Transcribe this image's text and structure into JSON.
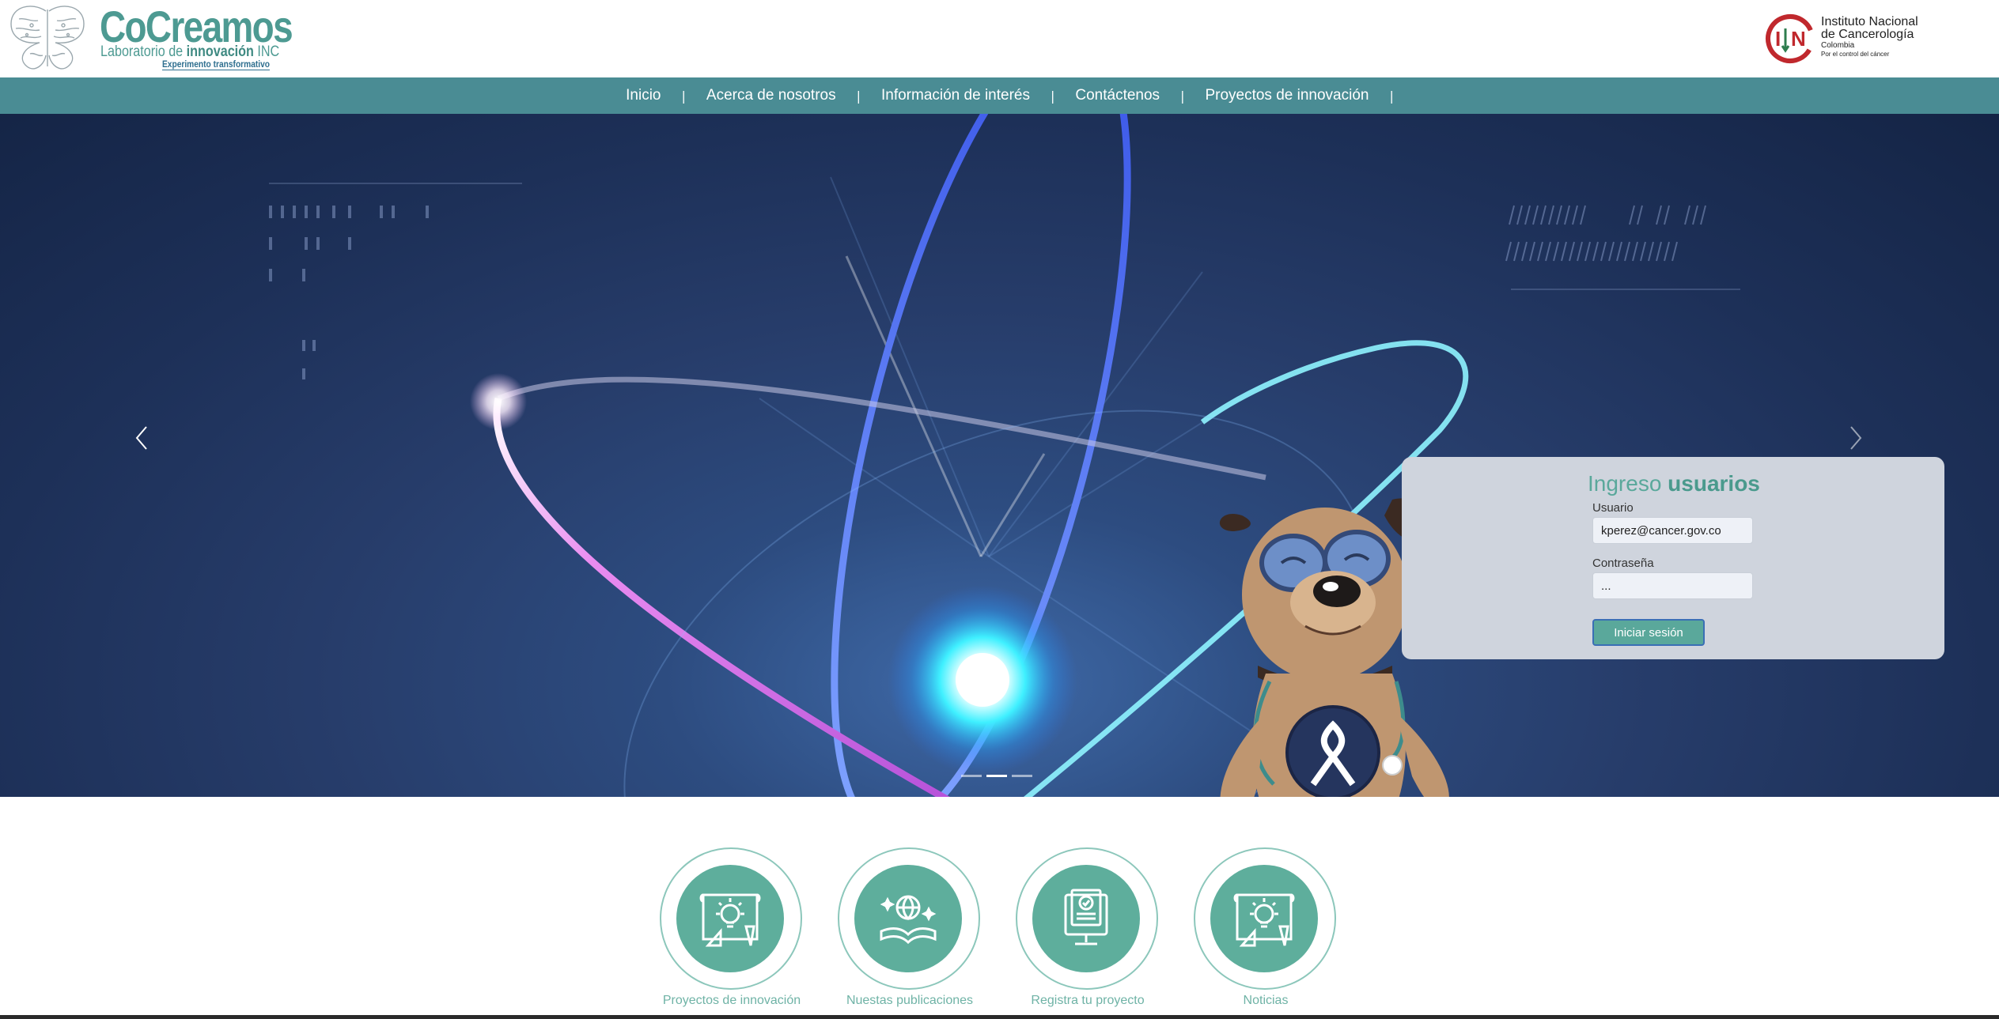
{
  "header": {
    "brand_title": "CoCreamos",
    "brand_sub_prefix": "Laboratorio de ",
    "brand_sub_bold": "innovación",
    "brand_sub_suffix": " INC",
    "brand_tagline": "Experimento transformativo",
    "institute_line1": "Instituto Nacional",
    "institute_line2": "de Cancerología",
    "institute_line3": "Colombia",
    "institute_line4": "Por el control del cáncer"
  },
  "nav": {
    "items": [
      {
        "label": "Inicio"
      },
      {
        "label": "Acerca de nosotros"
      },
      {
        "label": "Información de interés"
      },
      {
        "label": "Contáctenos"
      },
      {
        "label": "Proyectos de innovación"
      }
    ],
    "separator": "|"
  },
  "hero": {
    "prev_icon": "chevron-left-icon",
    "next_icon": "chevron-right-icon",
    "slides_count": 3,
    "active_slide": 1
  },
  "login": {
    "title_light": "Ingreso ",
    "title_bold": "usuarios",
    "user_label": "Usuario",
    "user_value": "kperez@cancer.gov.co",
    "pass_label": "Contraseña",
    "pass_value": "...",
    "submit_label": "Iniciar sesión"
  },
  "services": [
    {
      "label": "Proyectos de innovación",
      "icon": "blueprint-idea-icon"
    },
    {
      "label": "Nuestas publicaciones",
      "icon": "open-book-globe-icon"
    },
    {
      "label": "Registra tu proyecto",
      "icon": "register-document-icon"
    },
    {
      "label": "Noticias",
      "icon": "news-idea-icon"
    }
  ],
  "colors": {
    "brand_teal": "#4d9a92",
    "nav_bg": "#4a8c94",
    "service_disc": "#5eae9c",
    "service_label": "#6fb3a6",
    "login_bg": "#cfd4dd",
    "login_title": "#5aa89b"
  }
}
